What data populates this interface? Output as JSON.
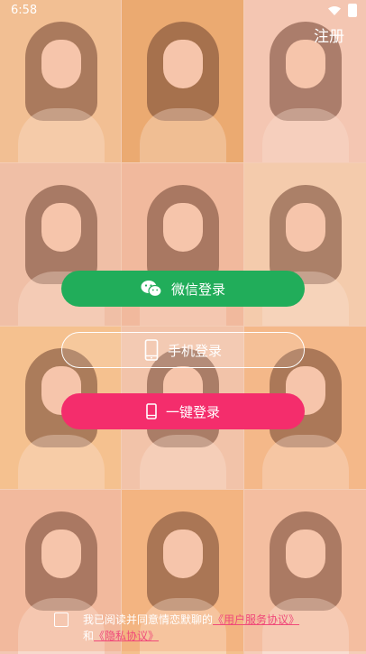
{
  "status_bar": {
    "time": "6:58"
  },
  "header": {
    "register_label": "注册"
  },
  "buttons": {
    "wechat_label": "微信登录",
    "phone_label": "手机登录",
    "onekey_label": "一键登录"
  },
  "agreement": {
    "prefix": "我已阅读并同意情恋默聊的",
    "user_agreement": "《用户服务协议》",
    "conjunction": "和",
    "privacy_policy": "《隐私协议》"
  },
  "colors": {
    "wechat_green": "#21ad5a",
    "onekey_pink": "#f42d6c",
    "link_pink": "#f04a7a"
  },
  "background_photos": [
    {
      "tone": "#f3cfa5"
    },
    {
      "tone": "#e9b277"
    },
    {
      "tone": "#f5d8d0"
    },
    {
      "tone": "#f0cfbf"
    },
    {
      "tone": "#f2c7b3"
    },
    {
      "tone": "#f5e0c8"
    },
    {
      "tone": "#f7d2a0"
    },
    {
      "tone": "#f3d4c4"
    },
    {
      "tone": "#f5c597"
    },
    {
      "tone": "#f3c7b3"
    },
    {
      "tone": "#f4c08c"
    },
    {
      "tone": "#f5cdb8"
    }
  ]
}
